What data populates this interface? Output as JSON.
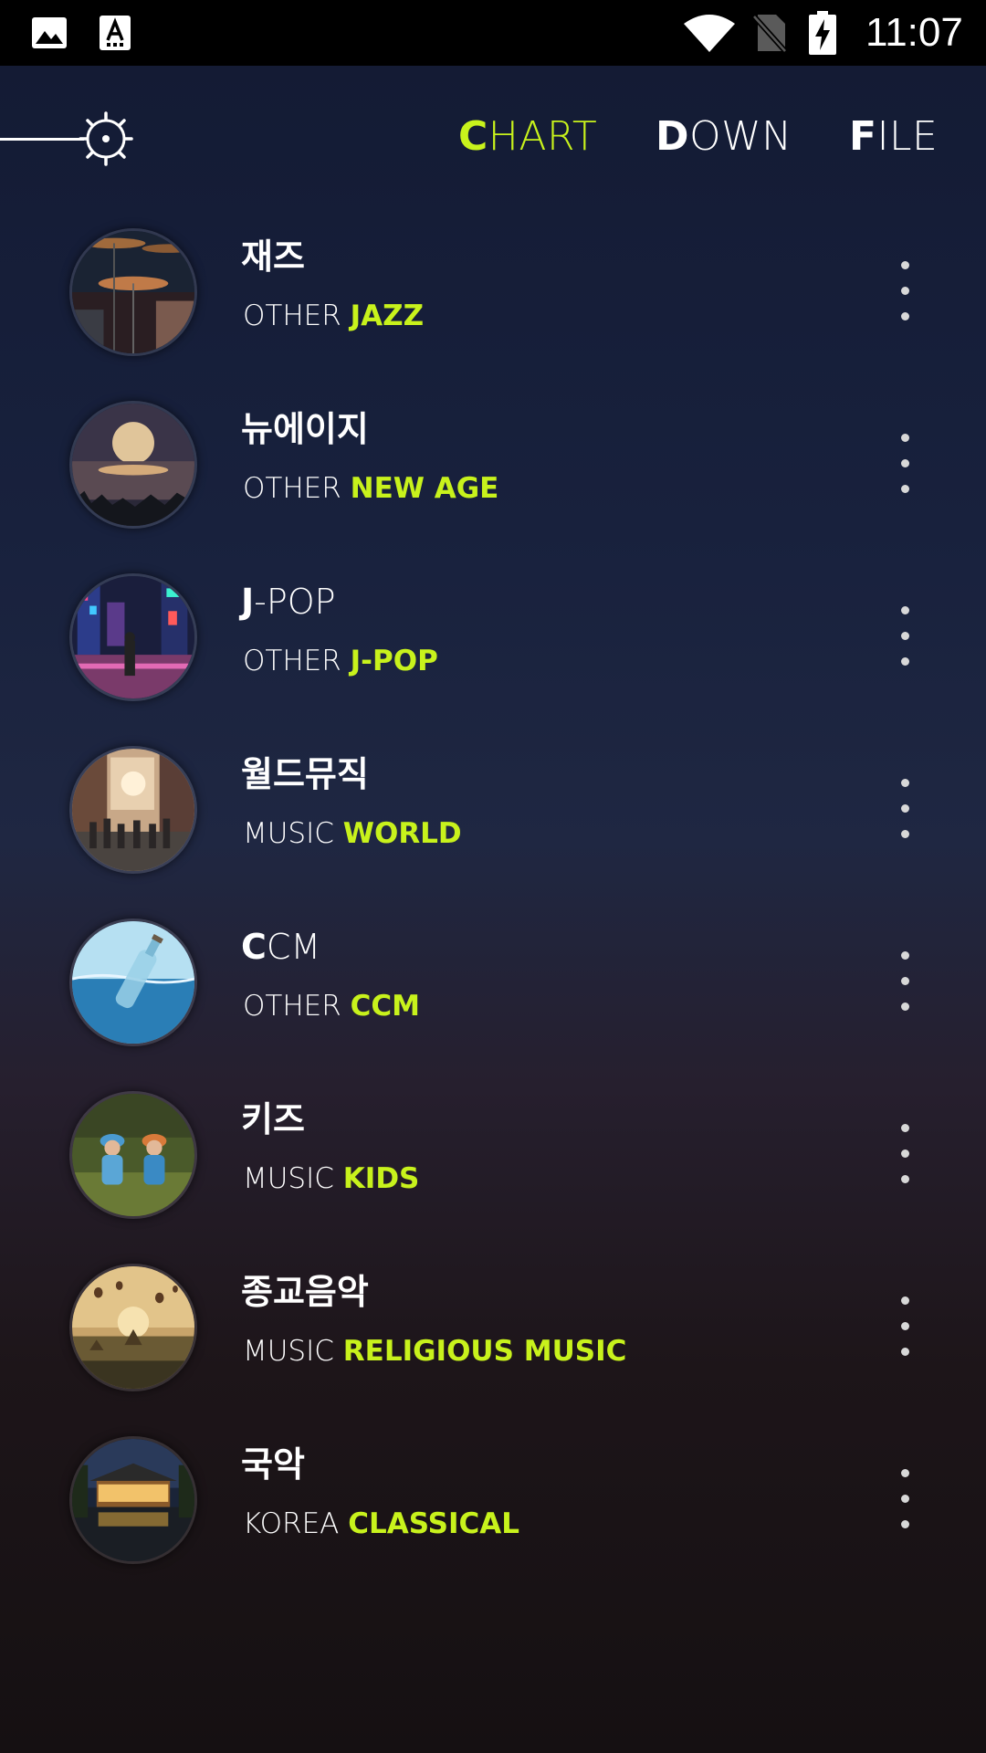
{
  "status_bar": {
    "time": "11:07",
    "icons": [
      "gallery-icon",
      "text-a-icon",
      "wifi-icon",
      "no-sim-icon",
      "battery-charging-icon"
    ]
  },
  "header": {
    "settings_icon": "settings-gear-icon",
    "tabs": [
      {
        "first": "C",
        "rest": "HART",
        "active": true
      },
      {
        "first": "D",
        "rest": "OWN",
        "active": false
      },
      {
        "first": "F",
        "rest": "ILE",
        "active": false
      }
    ]
  },
  "colors": {
    "accent": "#c8f21c",
    "background_top": "#131a33",
    "background_bottom": "#151012"
  },
  "items": [
    {
      "title": "재즈",
      "prefix": "OTHER",
      "genre": "JAZZ",
      "image": "drum-cymbals"
    },
    {
      "title": "뉴에이지",
      "prefix": "OTHER",
      "genre": "NEW AGE",
      "image": "moon-over-water"
    },
    {
      "title_first": "J",
      "title_rest": "-POP",
      "prefix": "OTHER",
      "genre": "J-POP",
      "image": "neon-city-street"
    },
    {
      "title": "월드뮤직",
      "prefix": "MUSIC",
      "genre": "WORLD",
      "image": "crowded-street"
    },
    {
      "title_first": "C",
      "title_rest": "CM",
      "prefix": "OTHER",
      "genre": "CCM",
      "image": "bottle-in-sea"
    },
    {
      "title": "키즈",
      "prefix": "MUSIC",
      "genre": "KIDS",
      "image": "children-in-grass"
    },
    {
      "title": "종교음악",
      "prefix": "MUSIC",
      "genre": "RELIGIOUS MUSIC",
      "image": "balloons-over-temples"
    },
    {
      "title": "국악",
      "prefix": "KOREA",
      "genre": "CLASSICAL",
      "image": "korean-palace-night"
    }
  ]
}
